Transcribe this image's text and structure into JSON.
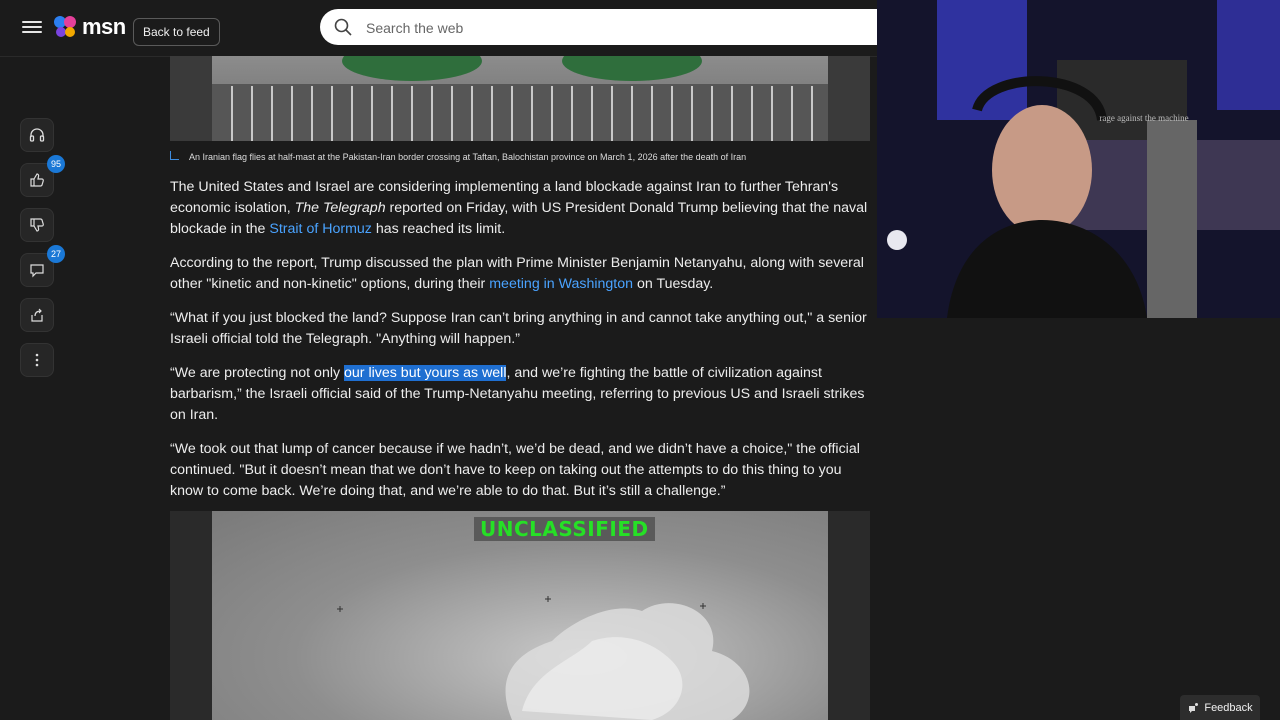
{
  "header": {
    "logo_text": "msn",
    "back_label": "Back to feed",
    "search_placeholder": "Search the web"
  },
  "rail": {
    "likes_count": "95",
    "comments_count": "27"
  },
  "caption": "An Iranian flag flies at half-mast at the Pakistan-Iran border crossing at Taftan, Balochistan province on March 1, 2026 after the death of Iran",
  "article": {
    "p1_a": "The United States and Israel are considering implementing a land blockade against Iran to further Tehran's economic isolation, ",
    "p1_em": "The Telegraph",
    "p1_b": " reported on Friday, with US President Donald Trump believing that the naval blockade in the ",
    "p1_link": "Strait of Hormuz",
    "p1_c": " has reached its limit.",
    "p2_a": "According to the report, Trump discussed the plan with Prime Minister Benjamin Netanyahu, along with several other \"kinetic and non-kinetic\" options, during their ",
    "p2_link": "meeting in Washington",
    "p2_b": " on Tuesday.",
    "p3": "“What if you just blocked the land? Suppose Iran can’t bring anything in and cannot take anything out,\" a senior Israeli official told the Telegraph. \"Anything will happen.”",
    "p4_a": "“We are protecting not only ",
    "p4_hl": "our lives but yours as well",
    "p4_b": ", and we’re fighting the battle of civilization against barbarism,” the Israeli official said of the Trump-Netanyahu meeting, referring to previous US and Israeli strikes on Iran.",
    "p5": "“We took out that lump of cancer because if we hadn’t, we’d be dead, and we didn’t have a choice,\" the official continued. \"But it doesn’t mean that we don’t have to keep on taking out the attempts to do this thing to you know to come back. We’re doing that, and we’re able to do that. But it’s still a challenge.”"
  },
  "video": {
    "overlay_text": "UNCLASSIFIED"
  },
  "webcam": {
    "poster_text": "rage against the machine"
  },
  "feedback_label": "Feedback"
}
